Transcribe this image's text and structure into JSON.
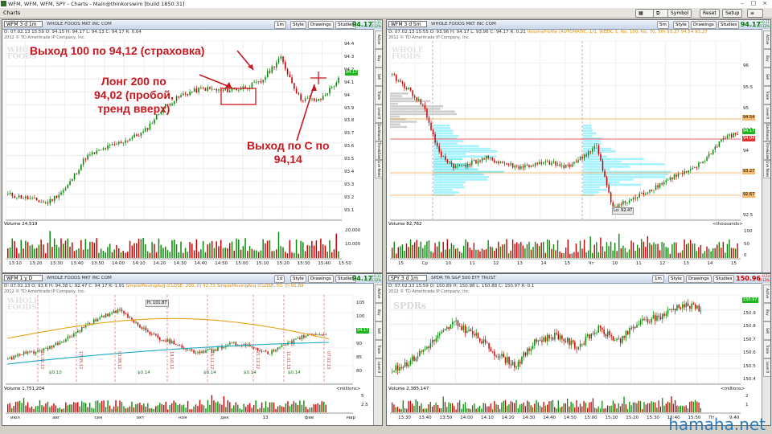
{
  "window": {
    "title": "WFM, WFM, WFM, SPY - Charts - Main@thinkorswim [build 1850.31]"
  },
  "menu": {
    "label": "Charts"
  },
  "toolbar": {
    "buttons": [
      "Symbol",
      "Reset",
      "Setup"
    ]
  },
  "annotations": {
    "exit_top": "Выход 100 по 94,12 (страховка)",
    "long": "Лонг 200 по\n94,02 (пробой,\nтренд вверх)",
    "exit_c": "Выход по С по\n94,14"
  },
  "panels": [
    {
      "symbol": "WFM 3 d 1m",
      "company": "WHOLE FOODS MKT INC COM",
      "buttons": [
        "1m",
        "Style",
        "Drawings",
        "Studies"
      ],
      "price": "94.17",
      "change": [
        "+0.11",
        "+0.12%"
      ],
      "quote": "D: 07.02.13 15:59 O: 94.15 H: 94.17 L: 94.13 C: 94.17 R: 0.04",
      "notice": "2012 © TD Ameritrade IP Company, Inc.",
      "watermark": [
        "WHOLE",
        "FOODS"
      ],
      "price_ticks": [
        "94.4",
        "94.3",
        "94.2",
        "94.1",
        "94",
        "93.9",
        "93.8",
        "93.7",
        "93.6",
        "93.5",
        "93.4",
        "93.3",
        "93.2",
        "93.1"
      ],
      "last_label": "94.17",
      "volume_label": "Volume 24,519",
      "volume_ticks": [
        "20,000",
        "10,000"
      ],
      "time_ticks": [
        "13:10",
        "13:20",
        "13:30",
        "13:40",
        "13:50",
        "14:00",
        "14:10",
        "14:20",
        "14:30",
        "14:40",
        "14:50",
        "15:00",
        "15:10",
        "15:20",
        "15:30",
        "15:40",
        "15:50"
      ]
    },
    {
      "symbol": "WFM 3 d 5m",
      "company": "WHOLE FOODS MKT INC COM",
      "buttons": [
        "5m",
        "Style",
        "Drawings",
        "Studies"
      ],
      "price": "94.17",
      "change": [
        "+0.11",
        "+0.12%"
      ],
      "quote": "D: 07.02.13 15:55 O: 93.96 H: 94.17 L: 93.96 C: 94.17 R: 0.21",
      "study": "VolumeProfile (AUTOMATIC, 1/1, WEEK, 1, No, 100, No, 70, 50) 93.27 94.54 93.27",
      "notice": "2012 © TD Ameritrade IP Company, Inc.",
      "watermark": [
        "WHOLE",
        "FOODS"
      ],
      "price_ticks": [
        "96",
        "95.5",
        "95",
        "94.5",
        "94",
        "93.5",
        "93",
        "92.5"
      ],
      "right_labels": [
        "94.54",
        "94.17",
        "94.04",
        "93.27",
        "92.67"
      ],
      "low_label": "Lo: 92.47",
      "volume_label": "Volume 82,762",
      "volume_ticks": [
        "100",
        "50",
        "0"
      ],
      "volume_units": "<thousands>",
      "time_ticks": [
        "15",
        "Ср",
        "10",
        "11",
        "12",
        "13",
        "14",
        "15",
        "Чт",
        "10",
        "11",
        "12",
        "13",
        "14",
        "15"
      ]
    },
    {
      "symbol": "WFM 1 y D",
      "company": "WHOLE FOODS MKT INC COM",
      "buttons": [
        "1d",
        "Style",
        "Drawings",
        "Studies"
      ],
      "price": "94.17",
      "change": [
        "+0.11",
        "+0.12%"
      ],
      "quote": "D: 07.02.13 O: 93.6 H: 94.38 L: 92.47 C: 94.17 R: 1.91",
      "study": "SimpleMovingAvg (CLOSE, 200, 0) 92.73   SimpleMovingAvg (CLOSE, 50, 0) 91.89",
      "notice": "2012 © TD Ameritrade IP Company, Inc.",
      "watermark": [
        "WHOLE",
        "FOODS"
      ],
      "hi_label": "H: 101.87",
      "price_ticks": [
        "105",
        "100",
        "95",
        "90",
        "85",
        "80"
      ],
      "last_label": "94.17",
      "events": [
        "21.02.12",
        "17.05.12",
        "03.08.12",
        "19.10.12",
        "16.11.12",
        "21.12.12",
        "11.01.13",
        "07.02.13"
      ],
      "dividends": [
        "$0.10",
        "$0.14",
        "$0.14",
        "$0.14",
        "$0.14"
      ],
      "volume_label": "Volume 1,751,204",
      "volume_ticks": [
        "5",
        "2.5"
      ],
      "volume_units": "<millions>",
      "time_ticks": [
        "июл",
        "авг",
        "сен",
        "окт",
        "ноя",
        "дек",
        "13",
        "фев",
        "мар"
      ]
    },
    {
      "symbol": "SPY 3 d 1m",
      "company": "SPDR TR S&P 500 ETF TRUST",
      "buttons": [
        "1m",
        "Style",
        "Drawings",
        "Studies"
      ],
      "price": "150.96",
      "change": [
        "-0.20",
        "-0.13%"
      ],
      "quote": "D: 07.02.13 15:59 O: 150.89 H: 150.98 L: 150.88 C: 150.97 R: 0.1",
      "notice": "2012 © TD Ameritrade IP Company, Inc.",
      "watermark": [
        "SPDRs"
      ],
      "price_ticks": [
        "151",
        "150.9",
        "150.8",
        "150.7",
        "150.6",
        "150.5",
        "150.4"
      ],
      "last_label": "150.97",
      "volume_label": "Volume 2,385,147",
      "volume_ticks": [
        "2",
        "1"
      ],
      "volume_units": "<millions>",
      "time_ticks": [
        "13:30",
        "13:40",
        "13:50",
        "14:00",
        "14:10",
        "14:20",
        "14:30",
        "14:40",
        "14:50",
        "15:00",
        "15:10",
        "15:20",
        "15:30",
        "15:40",
        "15:50",
        "Пт",
        "9:40"
      ]
    }
  ],
  "side_tabs": [
    "Active Trader",
    "Buy Custom",
    "Sell Custom",
    "Trade",
    "Level II",
    "Dashboard",
    "Time&Sales",
    "Live News"
  ],
  "footer_watermark": "hamaha.net",
  "colors": {
    "up": "#0a8a0a",
    "down": "#cc0000",
    "annotation": "#c8171e",
    "sma50": "#e8a317",
    "sma200": "#19a8c9",
    "profile": "#8ff0ff"
  }
}
